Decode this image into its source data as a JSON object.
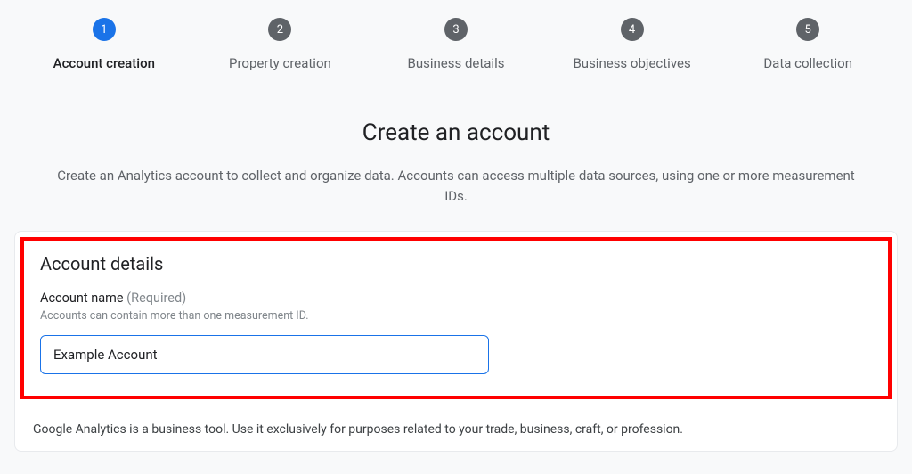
{
  "stepper": [
    {
      "num": "1",
      "label": "Account creation",
      "active": true
    },
    {
      "num": "2",
      "label": "Property creation",
      "active": false
    },
    {
      "num": "3",
      "label": "Business details",
      "active": false
    },
    {
      "num": "4",
      "label": "Business objectives",
      "active": false
    },
    {
      "num": "5",
      "label": "Data collection",
      "active": false
    }
  ],
  "heading": {
    "title": "Create an account",
    "subtitle": "Create an Analytics account to collect and organize data. Accounts can access multiple data sources, using one or more measurement IDs."
  },
  "form": {
    "section_title": "Account details",
    "account_name_label": "Account name",
    "account_name_required": "(Required)",
    "account_name_help": "Accounts can contain more than one measurement ID.",
    "account_name_value": "Example Account"
  },
  "disclaimer": "Google Analytics is a business tool. Use it exclusively for purposes related to your trade, business, craft, or profession."
}
